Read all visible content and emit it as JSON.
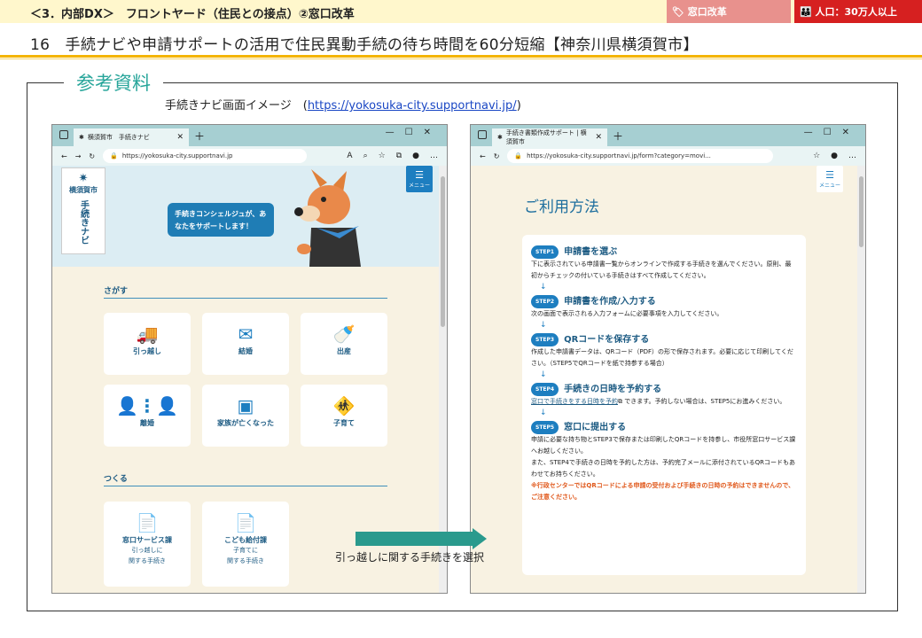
{
  "header": {
    "section": "＜3．内部DX＞　フロントヤード（住民との接点）②窓口改革",
    "tag1": "窓口改革",
    "tag2": "人口：30万人以上",
    "headline": "16　手続ナビや申請サポートの活用で住民異動手続の待ち時間を60分短縮【神奈川県横須賀市】"
  },
  "reference": {
    "title": "参考資料",
    "caption": "手続きナビ画面イメージ　(",
    "url": "https://yokosuka-city.supportnavi.jp/",
    "caption_end": ")"
  },
  "left_window": {
    "tab_label": "横須賀市　手続きナビ",
    "url": "https://yokosuka-city.supportnavi.jp",
    "logo_city": "横須賀市",
    "logo_vert": "手続きナビ",
    "bubble": "手続きコンシェルジュが、あなたをサポートします！",
    "menu": "メニュー",
    "section1": "さがす",
    "cards1": [
      "引っ越し",
      "結婚",
      "出産",
      "離婚",
      "家族が亡くなった",
      "子育て"
    ],
    "section2": "つくる",
    "cards2": [
      {
        "title": "窓口サービス課",
        "sub1": "引っ越しに",
        "sub2": "関する手続き"
      },
      {
        "title": "こども給付課",
        "sub1": "子育てに",
        "sub2": "関する手続き"
      }
    ]
  },
  "right_window": {
    "tab_label": "手続き書類作成サポート | 横須賀市",
    "url": "https://yokosuka-city.supportnavi.jp/form?category=movi...",
    "menu": "メニュー",
    "title": "ご利用方法",
    "steps": [
      {
        "badge": "STEP1",
        "head": "申請書を選ぶ",
        "text": "下に表示されている申請書一覧からオンラインで作成する手続きを選んでください。原則、最初からチェックの付いている手続きはすべて作成してください。"
      },
      {
        "badge": "STEP2",
        "head": "申請書を作成/入力する",
        "text": "次の画面で表示される入力フォームに必要事項を入力してください。"
      },
      {
        "badge": "STEP3",
        "head": "QRコードを保存する",
        "text": "作成した申請書データは、QRコード（PDF）の形で保存されます。必要に応じて印刷してください。（STEP5でQRコードを紙で持参する場合）"
      },
      {
        "badge": "STEP4",
        "head": "手続きの日時を予約する",
        "link": "窓口で手続きをする日時を予約",
        "text": "できます。予約しない場合は、STEP5にお進みください。"
      },
      {
        "badge": "STEP5",
        "head": "窓口に提出する",
        "text": "申請に必要な持ち物とSTEP3で保存または印刷したQRコードを持参し、市役所窓口サービス課へお越しください。",
        "text2": "また、STEP4で手続きの日時を予約した方は、予約完了メールに添付されているQRコードもあわせてお持ちください。",
        "note": "※行政センターではQRコードによる申請の受付および手続きの日時の予約はできませんので、ご注意ください。"
      }
    ]
  },
  "annotation": {
    "label": "引っ越しに関する手続きを選択"
  }
}
